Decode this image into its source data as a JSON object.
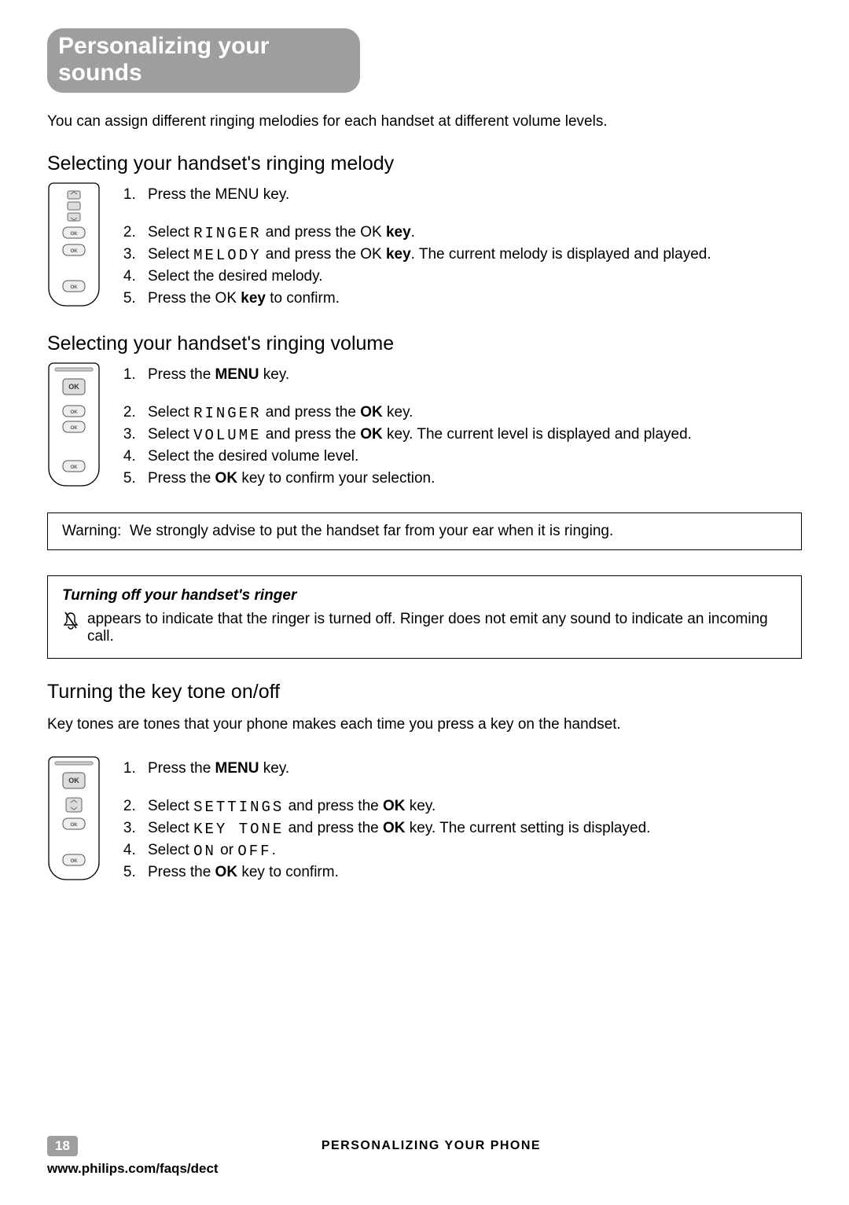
{
  "title": "Personalizing your sounds",
  "intro": "You can assign different ringing melodies for each handset at different volume levels.",
  "sections": {
    "melody": {
      "heading": "Selecting your handset's ringing melody",
      "steps": [
        {
          "pre": "Press the MENU key."
        },
        {
          "pre": "Select ",
          "lcd": "RINGER",
          "post": " and press the OK ",
          "bold": "key",
          "post2": "."
        },
        {
          "pre": "Select ",
          "lcd": "MELODY",
          "post": " and press the OK ",
          "bold": "key",
          "post2": ". The current melody is displayed and played."
        },
        {
          "pre": "Select the desired melody."
        },
        {
          "pre": "Press the OK ",
          "bold": "key",
          "post": " to confirm."
        }
      ]
    },
    "volume": {
      "heading": "Selecting your handset's ringing volume",
      "steps": [
        {
          "pre": "Press the ",
          "bold": "MENU",
          "post": " key."
        },
        {
          "pre": "Select ",
          "lcd": "RINGER",
          "post": " and press the ",
          "bold": "OK",
          "post2": " key."
        },
        {
          "pre": "Select ",
          "lcd": "VOLUME",
          "post": " and press the ",
          "bold": "OK",
          "post2": " key. The current level is displayed and played."
        },
        {
          "pre": "Select the desired volume level."
        },
        {
          "pre": "Press the ",
          "bold": "OK",
          "post": " key to confirm your selection."
        }
      ]
    },
    "keytone": {
      "heading": "Turning the key tone on/off",
      "intro": "Key tones are tones that your phone makes each time you press a key on the handset.",
      "steps": [
        {
          "pre": "Press the ",
          "bold": "MENU",
          "post": " key."
        },
        {
          "pre": "Select ",
          "lcd": "SETTINGS",
          "post": " and press the ",
          "bold": "OK",
          "post2": " key."
        },
        {
          "pre": "Select ",
          "lcd": "KEY TONE",
          "post": " and press the ",
          "bold": "OK",
          "post2": " key. The current setting is displayed."
        },
        {
          "pre": "Select ",
          "lcd": "ON",
          "mid": " or ",
          "lcd2": "OFF",
          "post": "."
        },
        {
          "pre": "Press the ",
          "bold": "OK",
          "post": " key to confirm."
        }
      ]
    }
  },
  "warning": {
    "label": "Warning:",
    "text": "We strongly advise to put the handset far from your ear when it is ringing."
  },
  "ringer_off_box": {
    "title": "Turning off your handset's ringer",
    "text": "appears to indicate that the ringer is turned off.  Ringer does not emit any sound to indicate an incoming call."
  },
  "footer": {
    "page": "18",
    "section_title": "PERSONALIZING YOUR PHONE",
    "url": "www.philips.com/faqs/dect"
  }
}
